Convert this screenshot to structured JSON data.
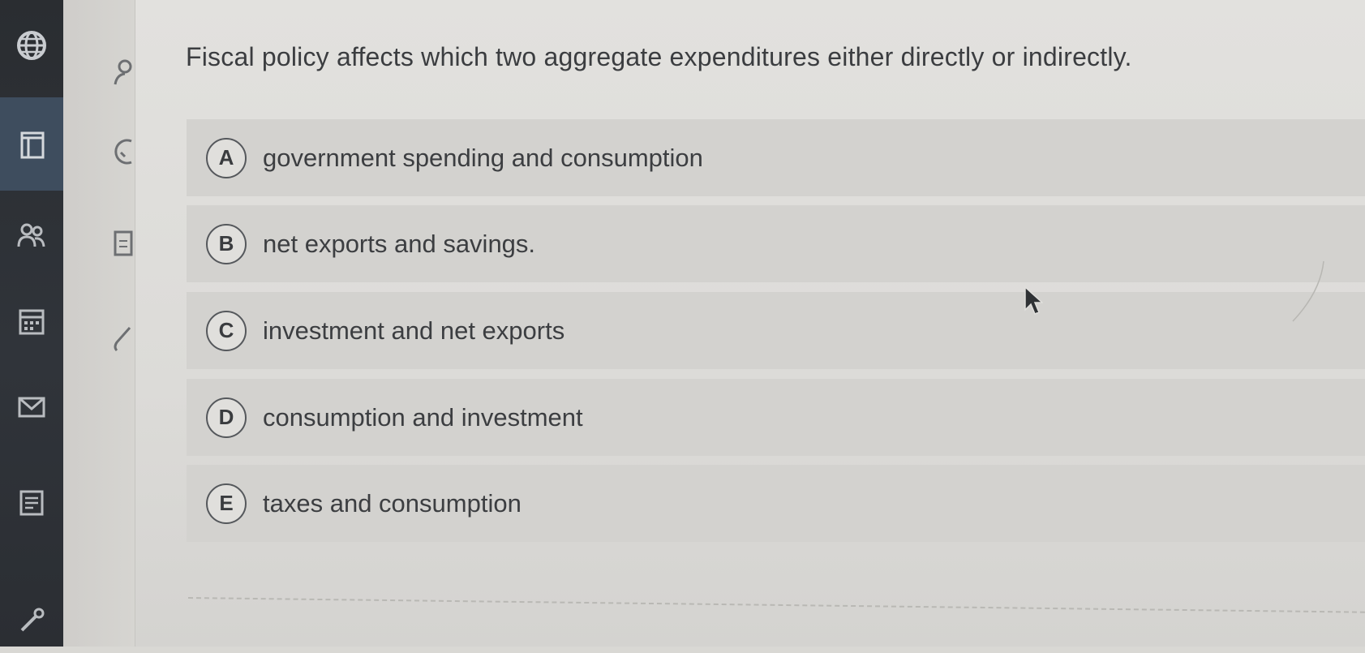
{
  "nav": {
    "items": [
      {
        "icon": "globe-icon"
      },
      {
        "icon": "notebook-icon",
        "active": true
      },
      {
        "icon": "people-icon"
      },
      {
        "icon": "calendar-icon"
      },
      {
        "icon": "mail-icon"
      },
      {
        "icon": "document-icon"
      },
      {
        "icon": "tools-icon"
      }
    ]
  },
  "question": {
    "text": "Fiscal policy affects which two aggregate expenditures either directly or indirectly."
  },
  "options": [
    {
      "letter": "A",
      "text": "government spending and consumption"
    },
    {
      "letter": "B",
      "text": "net exports and savings."
    },
    {
      "letter": "C",
      "text": "investment and net exports"
    },
    {
      "letter": "D",
      "text": "consumption and investment"
    },
    {
      "letter": "E",
      "text": "taxes and consumption"
    }
  ],
  "colors": {
    "rail": "#2a2d31",
    "rail_active": "#3e4d5e",
    "option_bg": "#d3d2cf",
    "text": "#3b3d40"
  }
}
